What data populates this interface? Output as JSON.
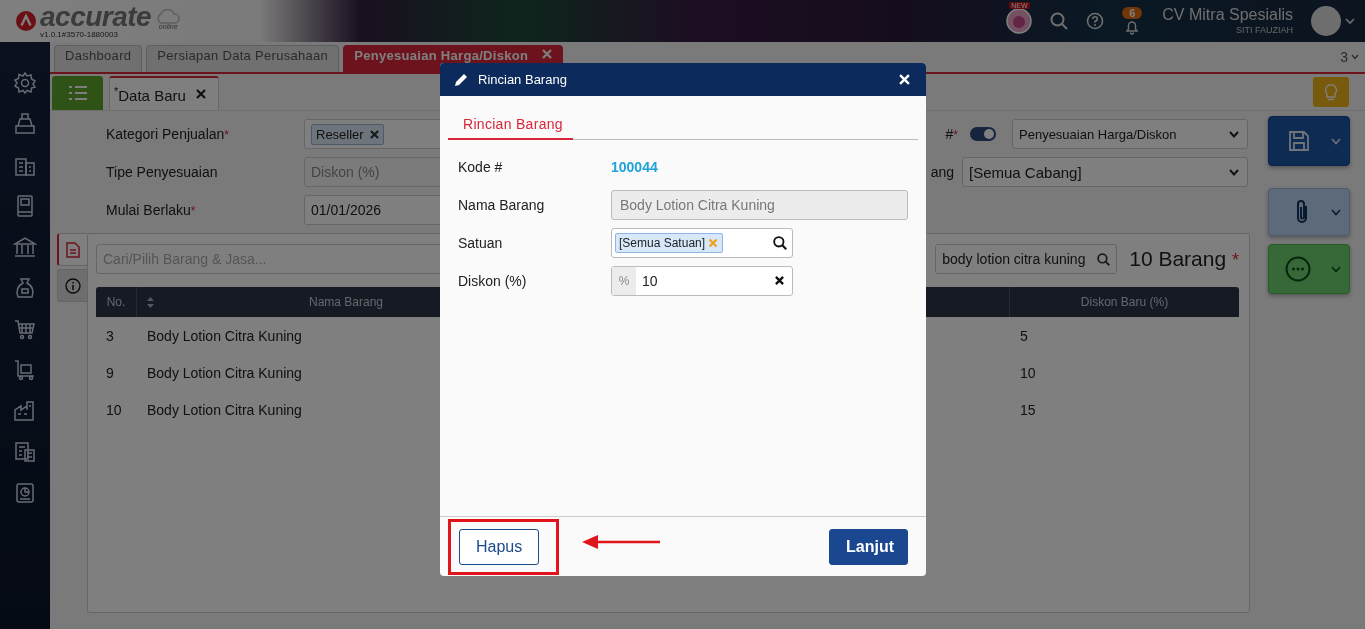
{
  "app": {
    "logo": "accurate",
    "logo_sub": "online",
    "version": "v1.0.1#3570-1880003"
  },
  "header": {
    "new_badge": "NEW",
    "notification_count": "6",
    "company": "CV Mitra Spesialis",
    "user": "SITI FAUZIAH"
  },
  "tabs": [
    {
      "label": "Dashboard",
      "selected": false
    },
    {
      "label": "Persiapan Data Perusahaan",
      "selected": false
    },
    {
      "label": "Penyesuaian Harga/Diskon",
      "selected": true
    }
  ],
  "tab_count": "3",
  "subtabs": [
    {
      "mark": "*",
      "label": "Data Baru",
      "selected": true
    }
  ],
  "form_left": [
    {
      "label": "Kategori Penjualan",
      "required_mark": "*",
      "kind": "chips",
      "chips": [
        "Reseller"
      ]
    },
    {
      "label": "Tipe Penyesuaian",
      "kind": "select",
      "value": "Diskon (%)",
      "disabled": true
    },
    {
      "label": "Mulai Berlaku",
      "required_mark": "*",
      "kind": "date",
      "value": "01/01/2026"
    }
  ],
  "form_right": [
    {
      "label": "#",
      "required_mark": "*",
      "kind": "toggle_select",
      "on": true,
      "value": "Penyesuaian Harga/Diskon"
    },
    {
      "label": "ang",
      "kind": "select",
      "value": "[Semua Cabang]"
    }
  ],
  "item_search": {
    "placeholder": "Cari/Pilih Barang & Jasa...",
    "filter": "body lotion citra kuning",
    "count": "10 Barang",
    "count_mark": "*"
  },
  "side_tabs": [
    {
      "kind": "document",
      "selected": true
    },
    {
      "kind": "info",
      "selected": false
    }
  ],
  "table": {
    "columns": [
      {
        "label": "No.",
        "sortable": false
      },
      {
        "label": "Nama Barang",
        "sortable": true
      },
      {
        "label": "Diskon Baru (%)",
        "sortable": false
      }
    ],
    "rows": [
      [
        "3",
        "Body Lotion Citra Kuning",
        "5"
      ],
      [
        "9",
        "Body Lotion Citra Kuning",
        "10"
      ],
      [
        "10",
        "Body Lotion Citra Kuning",
        "15"
      ]
    ]
  },
  "modal": {
    "title": "Rincian Barang",
    "tabs": [
      {
        "label": "Rincian Barang",
        "selected": true
      }
    ],
    "fields": [
      {
        "label": "Kode #",
        "kind": "link",
        "value": "100044"
      },
      {
        "label": "Nama Barang",
        "kind": "text",
        "value": "Body Lotion Citra Kuning",
        "disabled": true
      },
      {
        "label": "Satuan",
        "kind": "chips",
        "chips": [
          "[Semua Satuan]"
        ]
      },
      {
        "label": "Diskon (%)",
        "kind": "prefixed",
        "prefix": "%",
        "value": "10"
      }
    ],
    "buttons": [
      {
        "label": "Hapus",
        "kind": "secondary",
        "highlighted": true
      },
      {
        "label": "Lanjut",
        "kind": "primary",
        "highlighted": false
      }
    ]
  }
}
